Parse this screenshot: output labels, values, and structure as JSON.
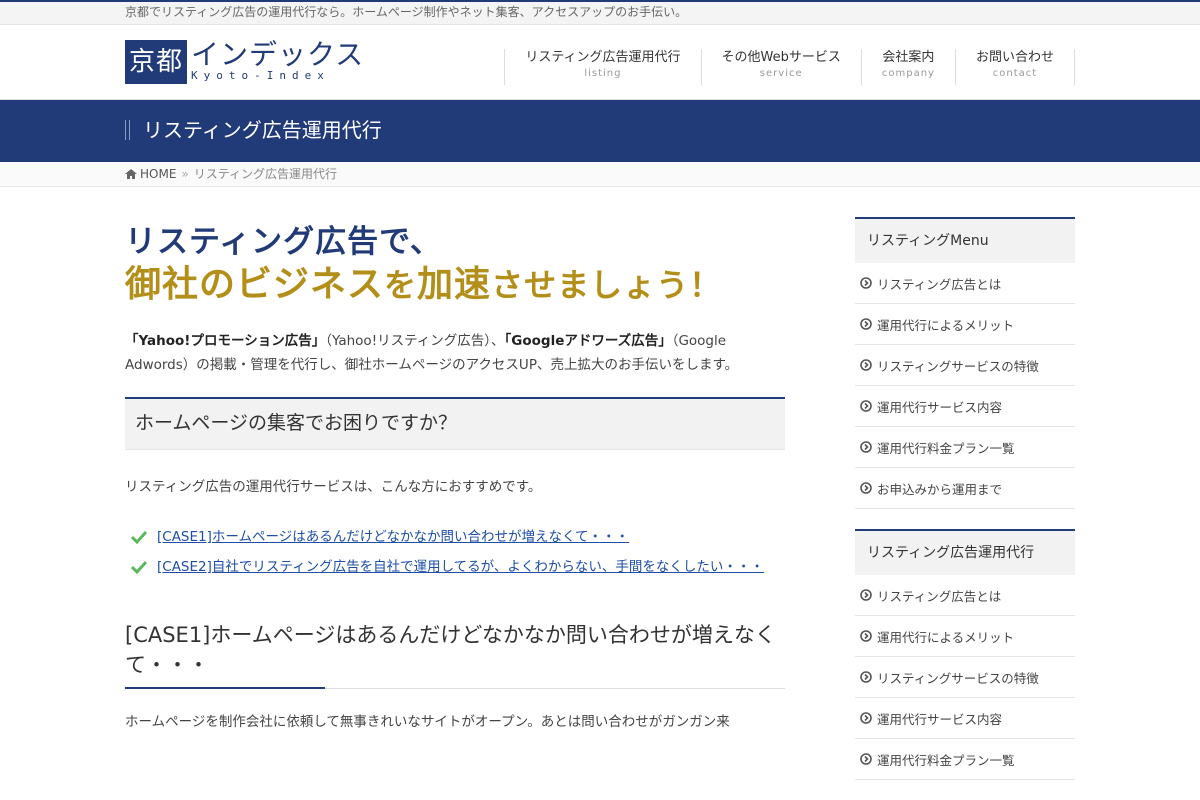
{
  "tagline": "京都でリスティング広告の運用代行なら。ホームページ制作やネット集客、アクセスアップのお手伝い。",
  "logo": {
    "box_text": "京都",
    "main_text": "インデックス",
    "sub_text": "Kyoto-Index"
  },
  "nav": [
    {
      "label": "リスティング広告運用代行",
      "sub": "listing"
    },
    {
      "label": "その他Webサービス",
      "sub": "service"
    },
    {
      "label": "会社案内",
      "sub": "company"
    },
    {
      "label": "お問い合わせ",
      "sub": "contact"
    }
  ],
  "page_title": "リスティング広告運用代行",
  "breadcrumb": {
    "home": "HOME",
    "separator": "»",
    "current": "リスティング広告運用代行"
  },
  "hero": {
    "line1": "リスティング広告で、",
    "line2_part1": "御社の",
    "line2_part2": "ビジネス",
    "line2_part3": "を",
    "line2_part4": "加速",
    "line2_part5": "させましょう！"
  },
  "intro": {
    "yahoo_label": "「Yahoo!プロモーション広告」",
    "yahoo_note": "（Yahoo!リスティング広告）、",
    "google_label": "「Googleアドワーズ広告」",
    "google_note": "（Google Adwords）の掲載・管理を代行し、御社ホームページのアクセスUP、売上拡大のお手伝いをします。"
  },
  "section_heading": "ホームページの集客でお困りですか？",
  "section_text": "リスティング広告の運用代行サービスは、こんな方におすすめです。",
  "cases": [
    {
      "text": "[CASE1]ホームページはあるんだけどなかなか問い合わせが増えなくて・・・"
    },
    {
      "text": "[CASE2]自社でリスティング広告を自社で運用してるが、よくわからない、手間をなくしたい・・・"
    }
  ],
  "case1_heading": "[CASE1]ホームページはあるんだけどなかなか問い合わせが増えなくて・・・",
  "case1_text": "ホームページを制作会社に依頼して無事きれいなサイトがオープン。あとは問い合わせがガンガン来",
  "sidebar": [
    {
      "title": "リスティングMenu",
      "items": [
        "リスティング広告とは",
        "運用代行によるメリット",
        "リスティングサービスの特徴",
        "運用代行サービス内容",
        "運用代行料金プラン一覧",
        "お申込みから運用まで"
      ]
    },
    {
      "title": "リスティング広告運用代行",
      "items": [
        "リスティング広告とは",
        "運用代行によるメリット",
        "リスティングサービスの特徴",
        "運用代行サービス内容",
        "運用代行料金プラン一覧"
      ]
    }
  ],
  "colors": {
    "brand_navy": "#213a78",
    "hero_gold": "#b38f1a",
    "link_blue": "#1e4ea8",
    "check_green": "#5cb85c"
  }
}
